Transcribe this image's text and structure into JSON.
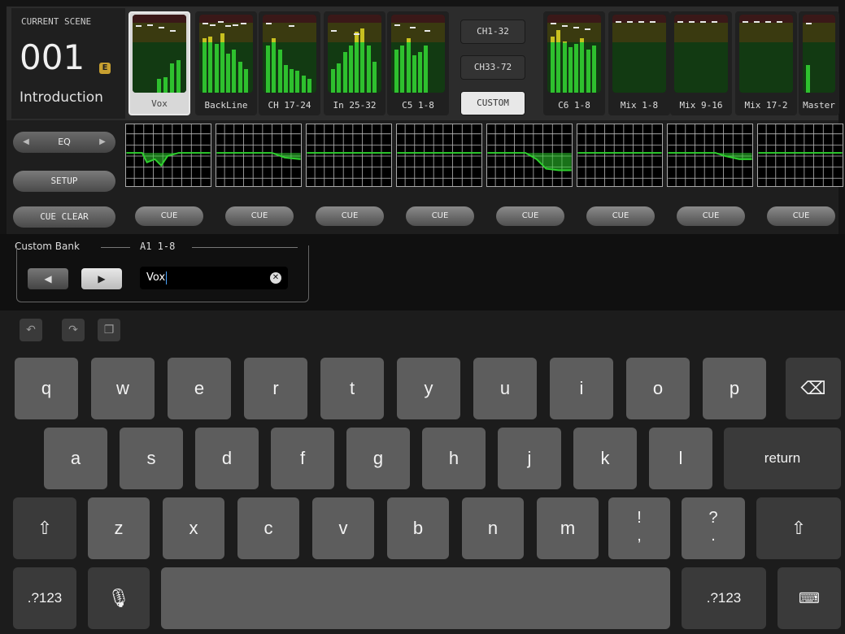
{
  "scene": {
    "label": "CURRENT SCENE",
    "number": "001",
    "badge": "E",
    "name": "Introduction"
  },
  "tiles": [
    {
      "name": "Vox",
      "selected": true,
      "levels": [
        0.18,
        0.2,
        0.38,
        0.42
      ],
      "peaks": [
        0.86,
        0.88,
        0.84,
        0.8
      ]
    },
    {
      "name": "BackLine",
      "levels": [
        0.7,
        0.72,
        0.62,
        0.76,
        0.5,
        0.55,
        0.4,
        0.3
      ],
      "peaks": [
        0.9,
        0.88,
        0.92,
        0.86,
        0.88,
        0.9
      ]
    },
    {
      "name": "CH 17-24",
      "levels": [
        0.6,
        0.7,
        0.55,
        0.35,
        0.3,
        0.28,
        0.22,
        0.18
      ],
      "peaks": [
        0.9,
        0.86
      ]
    },
    {
      "name": "In 25-32",
      "levels": [
        0.3,
        0.38,
        0.52,
        0.6,
        0.78,
        0.82,
        0.6,
        0.4
      ],
      "peaks": [
        0.8,
        0.76
      ]
    },
    {
      "name": "C5 1-8",
      "levels": [
        0.55,
        0.6,
        0.7,
        0.48,
        0.52,
        0.6
      ],
      "peaks": [
        0.88,
        0.84,
        0.8
      ]
    },
    {
      "name": "C6 1-8",
      "levels": [
        0.72,
        0.8,
        0.66,
        0.58,
        0.62,
        0.7,
        0.55,
        0.6
      ],
      "peaks": [
        0.9,
        0.86,
        0.84,
        0.82
      ]
    },
    {
      "name": "Mix 1-8",
      "levels": [],
      "peaks": [
        0.92,
        0.92,
        0.92,
        0.92
      ]
    },
    {
      "name": "Mix 9-16",
      "levels": [],
      "peaks": [
        0.92,
        0.92,
        0.92,
        0.92
      ]
    },
    {
      "name": "Mix 17-2",
      "levels": [],
      "peaks": [
        0.92,
        0.92,
        0.92,
        0.92
      ]
    },
    {
      "name": "Master",
      "levels": [
        0.35
      ],
      "peaks": [
        0.9
      ]
    }
  ],
  "banks": [
    "CH1-32",
    "CH33-72",
    "CUSTOM"
  ],
  "controls": {
    "eq_label": "EQ",
    "setup_label": "SETUP",
    "cue_clear_label": "CUE CLEAR",
    "cue_label": "CUE"
  },
  "custom_bank": {
    "title": "Custom Bank",
    "bank": "A1 1-8",
    "name_value": "Vox"
  },
  "keyboard": {
    "row1": [
      "q",
      "w",
      "e",
      "r",
      "t",
      "y",
      "u",
      "i",
      "o",
      "p"
    ],
    "row2": [
      "a",
      "s",
      "d",
      "f",
      "g",
      "h",
      "j",
      "k",
      "l"
    ],
    "row3": [
      "z",
      "x",
      "c",
      "v",
      "b",
      "n",
      "m"
    ],
    "punct1": [
      "!",
      ","
    ],
    "punct2": [
      "?",
      "."
    ],
    "return_label": "return",
    "numbers_label": ".?123"
  },
  "icons": [
    "undo-icon",
    "redo-icon",
    "paste-icon",
    "backspace-icon",
    "shift-icon",
    "mic-icon",
    "keyboard-hide-icon",
    "clear-icon",
    "left-arrow-icon",
    "right-arrow-icon"
  ],
  "colors": {
    "meter_green": "#2ec02e",
    "meter_yellow": "#c8c020",
    "eq_curve": "#2ed02e",
    "caret": "#4aa3ff"
  }
}
